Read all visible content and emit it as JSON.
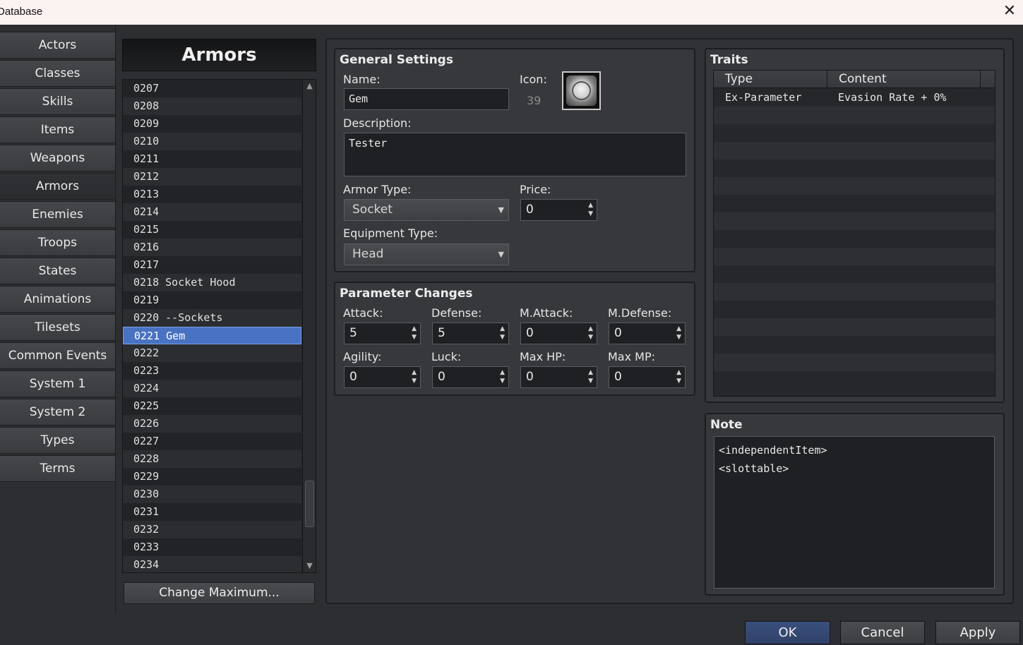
{
  "window": {
    "title": "Database",
    "close_icon": "close-icon"
  },
  "sidebar": {
    "items": [
      {
        "label": "Actors"
      },
      {
        "label": "Classes"
      },
      {
        "label": "Skills"
      },
      {
        "label": "Items"
      },
      {
        "label": "Weapons"
      },
      {
        "label": "Armors",
        "active": true
      },
      {
        "label": "Enemies"
      },
      {
        "label": "Troops"
      },
      {
        "label": "States"
      },
      {
        "label": "Animations"
      },
      {
        "label": "Tilesets"
      },
      {
        "label": "Common Events"
      },
      {
        "label": "System 1"
      },
      {
        "label": "System 2"
      },
      {
        "label": "Types"
      },
      {
        "label": "Terms"
      }
    ]
  },
  "list": {
    "title": "Armors",
    "rows": [
      {
        "text": "0207"
      },
      {
        "text": "0208"
      },
      {
        "text": "0209"
      },
      {
        "text": "0210"
      },
      {
        "text": "0211"
      },
      {
        "text": "0212"
      },
      {
        "text": "0213"
      },
      {
        "text": "0214"
      },
      {
        "text": "0215"
      },
      {
        "text": "0216"
      },
      {
        "text": "0217"
      },
      {
        "text": "0218 Socket Hood"
      },
      {
        "text": "0219"
      },
      {
        "text": "0220 --Sockets"
      },
      {
        "text": "0221 Gem",
        "selected": true
      },
      {
        "text": "0222"
      },
      {
        "text": "0223"
      },
      {
        "text": "0224"
      },
      {
        "text": "0225"
      },
      {
        "text": "0226"
      },
      {
        "text": "0227"
      },
      {
        "text": "0228"
      },
      {
        "text": "0229"
      },
      {
        "text": "0230"
      },
      {
        "text": "0231"
      },
      {
        "text": "0232"
      },
      {
        "text": "0233"
      },
      {
        "text": "0234"
      }
    ],
    "change_max_label": "Change Maximum..."
  },
  "general": {
    "title": "General Settings",
    "name_label": "Name:",
    "name_value": "Gem",
    "icon_label": "Icon:",
    "icon_index": "39",
    "description_label": "Description:",
    "description_value": "Tester",
    "armor_type_label": "Armor Type:",
    "armor_type_value": "Socket",
    "price_label": "Price:",
    "price_value": "0",
    "equip_type_label": "Equipment Type:",
    "equip_type_value": "Head"
  },
  "params": {
    "title": "Parameter Changes",
    "attack_label": "Attack:",
    "attack": "5",
    "defense_label": "Defense:",
    "defense": "5",
    "mattack_label": "M.Attack:",
    "mattack": "0",
    "mdefense_label": "M.Defense:",
    "mdefense": "0",
    "agility_label": "Agility:",
    "agility": "0",
    "luck_label": "Luck:",
    "luck": "0",
    "maxhp_label": "Max HP:",
    "maxhp": "0",
    "maxmp_label": "Max MP:",
    "maxmp": "0"
  },
  "traits": {
    "title": "Traits",
    "col_type": "Type",
    "col_content": "Content",
    "rows": [
      {
        "type": "Ex-Parameter",
        "content": "Evasion Rate + 0%"
      }
    ]
  },
  "note": {
    "title": "Note",
    "text": "<independentItem>\n<slottable>"
  },
  "buttons": {
    "ok": "OK",
    "cancel": "Cancel",
    "apply": "Apply"
  }
}
